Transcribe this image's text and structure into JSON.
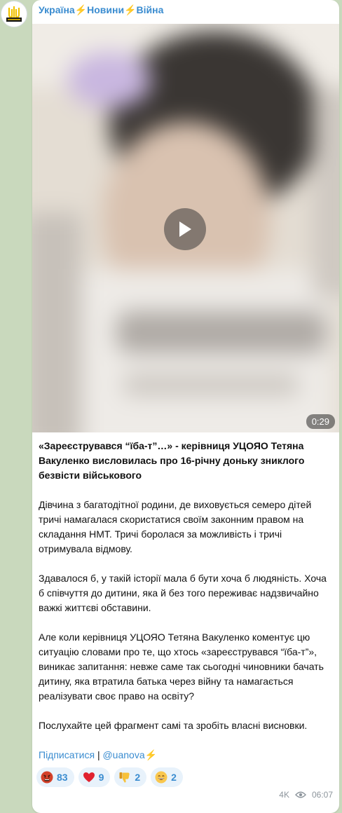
{
  "channel": {
    "name": "Україна⚡️Новини⚡️Війна"
  },
  "video": {
    "duration": "0:29"
  },
  "post": {
    "headline": "«Зареєструвався “їба-т”…» - керівниця УЦОЯО Тетяна Вакуленко висловилась про 16-річну доньку зниклого безвісти військового",
    "paragraphs": [
      "Дівчина з багатодітної родини, де виховується семеро дітей тричі намагалася скористатися своїм законним правом на складання НМТ. Тричі боролася за можливість і тричі отримувала відмову.",
      "Здавалося б, у такій історії мала б бути хоча б людяність. Хоча б співчуття до дитини, яка й без того переживає надзвичайно важкі життєві обставини.",
      "Але коли керівниця УЦОЯО Тетяна Вакуленко коментує цю ситуацію словами про те, що хтось «зареєструвався “їба-т”», виникає запитання: невже саме так сьогодні чиновники бачать дитину, яка втратила батька через війну та намагається реалізувати своє право на освіту?",
      "Послухайте цей фрагмент самі та зробіть власні висновки."
    ],
    "subscribe_link": "Підписатися",
    "separator": "|",
    "channel_link": "@uanova⚡️"
  },
  "reactions": [
    {
      "emoji": "angry-face-icon",
      "count": "83"
    },
    {
      "emoji": "red-heart-icon",
      "count": "9"
    },
    {
      "emoji": "thumbs-down-icon",
      "count": "2"
    },
    {
      "emoji": "grinning-face-icon",
      "count": "2"
    }
  ],
  "meta": {
    "views": "4K",
    "time": "06:07"
  },
  "colors": {
    "accent": "#3a8cd0",
    "background": "#c9d9bd",
    "reaction_bg": "#e8f2fb"
  }
}
